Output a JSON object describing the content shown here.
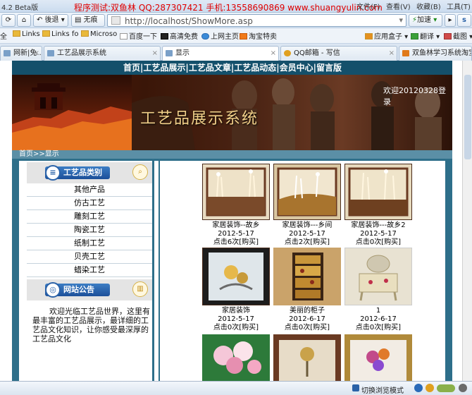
{
  "window": {
    "title": "4.2 Beta版",
    "ad_text": "程序测试:双鱼林 QQ:287307421 手机:13558690869 www.shuangyulin.com",
    "menus": [
      "文件(F)",
      "查看(V)",
      "收藏(B)",
      "工具(T)"
    ]
  },
  "toolbar": {
    "back_label": "後退",
    "view_label": "无痕",
    "url": "http://localhost/ShowMore.asp",
    "accel_label": "加速"
  },
  "bookmarks": [
    "全",
    "Links",
    "Links fo",
    "Microso",
    "百度一下",
    "高清免费",
    "上网主页",
    "淘宝特卖",
    "应用盒子",
    "翻译",
    "截图"
  ],
  "tabs": [
    {
      "label": "网新|免..."
    },
    {
      "label": "工艺品展示系统"
    },
    {
      "label": "显示",
      "active": true
    },
    {
      "label": "QQ邮箱 - 写信"
    },
    {
      "label": "双鱼林学习系统淘宝"
    }
  ],
  "site": {
    "nav": [
      "首页",
      "工艺品展示",
      "工艺品文章",
      "工艺品动态",
      "会员中心",
      "留言版"
    ],
    "banner_title": "工艺品展示系统",
    "welcome": "欢迎20120328登录",
    "breadcrumb": {
      "home": "首页",
      "sep": ">>",
      "current": "显示"
    },
    "category_heading": "工艺品类别",
    "categories": [
      "其他产品",
      "仿古工艺",
      "雕刻工艺",
      "陶瓷工艺",
      "纸制工艺",
      "贝壳工艺",
      "蜡染工艺"
    ],
    "notice_heading": "网站公告",
    "notice_text": "欢迎光临工艺品世界，这里有最丰富的工艺品展示，最详细的工艺品文化知识，让你感受最深厚的工艺品文化",
    "products": [
      {
        "name": "家居装饰--故乡",
        "date": "2012-5-17",
        "count": "点击6次",
        "buy": "[购买]"
      },
      {
        "name": "家居装饰---乡间",
        "date": "2012-5-17",
        "count": "点击2次",
        "buy": "[购买]"
      },
      {
        "name": "家居装饰---故乡2",
        "date": "2012-5-17",
        "count": "点击0次",
        "buy": "[购买]"
      },
      {
        "name": "家居装饰",
        "date": "2012-5-17",
        "count": "点击0次",
        "buy": "[购买]"
      },
      {
        "name": "美丽的柜子",
        "date": "2012-6-17",
        "count": "点击0次",
        "buy": "[购买]"
      },
      {
        "name": "1",
        "date": "2012-6-17",
        "count": "点击0次",
        "buy": "[购买]"
      }
    ]
  },
  "status": {
    "mode_label": "切换浏览模式"
  },
  "colors": {
    "nav_bg": "#14506b",
    "frame": "#2e6f8a",
    "ad_red": "#e00000"
  }
}
